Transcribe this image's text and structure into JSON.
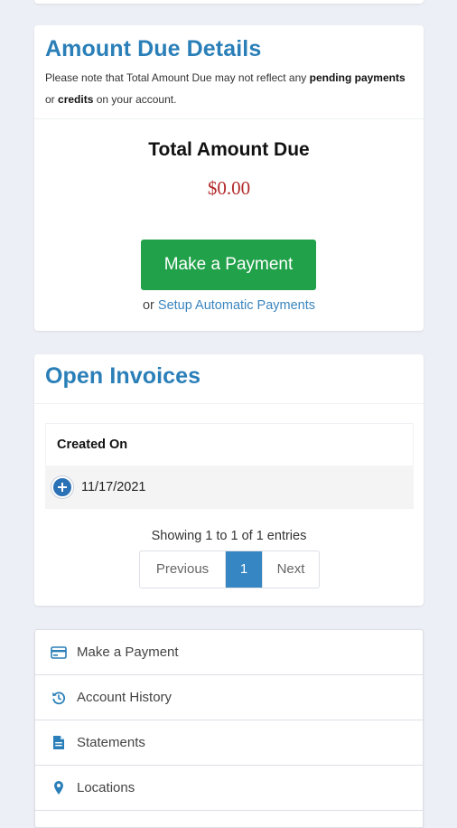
{
  "amount_due": {
    "title": "Amount Due Details",
    "note_prefix": "Please note that Total Amount Due may not reflect any",
    "note_bold1": "pending payments",
    "note_mid": "or",
    "note_bold2": "credits",
    "note_suffix": "on your account.",
    "total_label": "Total Amount Due",
    "total_value": "$0.00",
    "pay_button": "Make a Payment",
    "auto_prefix": "or",
    "auto_link": "Setup Automatic Payments",
    "colors": {
      "title": "#2a7fb8",
      "amount": "#b22a2a",
      "button": "#21a149",
      "link": "#3a85bf"
    }
  },
  "invoices": {
    "title": "Open Invoices",
    "column_header": "Created On",
    "rows": [
      {
        "created_on": "11/17/2021"
      }
    ],
    "showing": "Showing 1 to 1 of 1 entries",
    "pager": {
      "previous": "Previous",
      "current": "1",
      "next": "Next"
    },
    "colors": {
      "active_page": "#3586c2"
    }
  },
  "menu": {
    "items": [
      {
        "label": "Make a Payment",
        "icon": "credit-card-icon"
      },
      {
        "label": "Account History",
        "icon": "history-icon"
      },
      {
        "label": "Statements",
        "icon": "document-icon"
      },
      {
        "label": "Locations",
        "icon": "map-pin-icon"
      }
    ],
    "colors": {
      "icon": "#2a7fb8"
    }
  }
}
